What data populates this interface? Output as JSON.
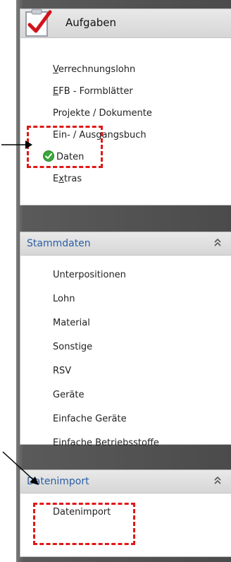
{
  "aufgaben": {
    "title": "Aufgaben",
    "items": [
      {
        "label_u": "V",
        "label_rest": "errechnungslohn"
      },
      {
        "label_u": "E",
        "label_rest": "FB - Formblätter"
      },
      {
        "label_u": "",
        "label_rest": "Projekte / Dokumente"
      },
      {
        "label_u": "",
        "label_rest": "Ein- / Ausgangsbuch"
      },
      {
        "label_u": "",
        "label_rest": "Daten"
      },
      {
        "label_u": "x",
        "label_pre": "E",
        "label_rest": "tras"
      }
    ]
  },
  "stammdaten": {
    "title": "Stammdaten",
    "items": [
      "Unterpositionen",
      "Lohn",
      "Material",
      "Sonstige",
      "RSV",
      "Geräte",
      "Einfache Geräte",
      "Einfache Betriebsstoffe"
    ]
  },
  "datenimport": {
    "title": "Datenimport",
    "items": [
      "Datenimport"
    ]
  },
  "colors": {
    "accent": "#2a5ea6",
    "highlight": "#e01818",
    "check": "#3aa83a"
  },
  "icons": [
    "clipboard-check-icon",
    "green-check-icon",
    "chevron-up-icon"
  ]
}
